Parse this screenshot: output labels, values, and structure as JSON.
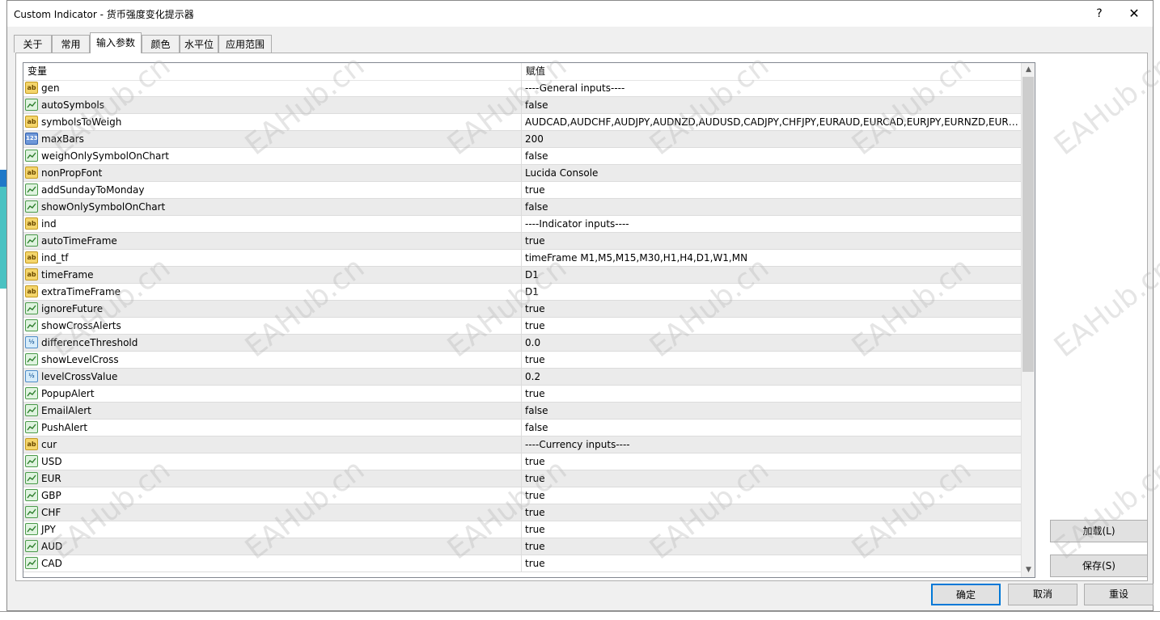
{
  "window": {
    "title": "Custom Indicator - 货币强度变化提示器",
    "help_label": "?",
    "close_label": "✕"
  },
  "tabs": [
    {
      "label": "关于"
    },
    {
      "label": "常用"
    },
    {
      "label": "输入参数"
    },
    {
      "label": "颜色"
    },
    {
      "label": "水平位"
    },
    {
      "label": "应用范围"
    }
  ],
  "grid": {
    "header_variable": "变量",
    "header_value": "赋值",
    "rows": [
      {
        "type": "string",
        "icon": "string-type-icon",
        "name": "gen",
        "value": "----General inputs----"
      },
      {
        "type": "bool",
        "icon": "bool-type-icon",
        "name": "autoSymbols",
        "value": "false"
      },
      {
        "type": "string",
        "icon": "string-type-icon",
        "name": "symbolsToWeigh",
        "value": "AUDCAD,AUDCHF,AUDJPY,AUDNZD,AUDUSD,CADJPY,CHFJPY,EURAUD,EURCAD,EURJPY,EURNZD,EURUS..."
      },
      {
        "type": "int",
        "icon": "int-type-icon",
        "name": "maxBars",
        "value": "200"
      },
      {
        "type": "bool",
        "icon": "bool-type-icon",
        "name": "weighOnlySymbolOnChart",
        "value": "false"
      },
      {
        "type": "string",
        "icon": "string-type-icon",
        "name": "nonPropFont",
        "value": "Lucida Console"
      },
      {
        "type": "bool",
        "icon": "bool-type-icon",
        "name": "addSundayToMonday",
        "value": "true"
      },
      {
        "type": "bool",
        "icon": "bool-type-icon",
        "name": "showOnlySymbolOnChart",
        "value": "false"
      },
      {
        "type": "string",
        "icon": "string-type-icon",
        "name": "ind",
        "value": "----Indicator inputs----"
      },
      {
        "type": "bool",
        "icon": "bool-type-icon",
        "name": "autoTimeFrame",
        "value": "true"
      },
      {
        "type": "string",
        "icon": "string-type-icon",
        "name": "ind_tf",
        "value": "timeFrame M1,M5,M15,M30,H1,H4,D1,W1,MN"
      },
      {
        "type": "string",
        "icon": "string-type-icon",
        "name": "timeFrame",
        "value": "D1"
      },
      {
        "type": "string",
        "icon": "string-type-icon",
        "name": "extraTimeFrame",
        "value": "D1"
      },
      {
        "type": "bool",
        "icon": "bool-type-icon",
        "name": "ignoreFuture",
        "value": "true"
      },
      {
        "type": "bool",
        "icon": "bool-type-icon",
        "name": "showCrossAlerts",
        "value": "true"
      },
      {
        "type": "double",
        "icon": "double-type-icon",
        "name": "differenceThreshold",
        "value": "0.0"
      },
      {
        "type": "bool",
        "icon": "bool-type-icon",
        "name": "showLevelCross",
        "value": "true"
      },
      {
        "type": "double",
        "icon": "double-type-icon",
        "name": "levelCrossValue",
        "value": "0.2"
      },
      {
        "type": "bool",
        "icon": "bool-type-icon",
        "name": "PopupAlert",
        "value": "true"
      },
      {
        "type": "bool",
        "icon": "bool-type-icon",
        "name": "EmailAlert",
        "value": "false"
      },
      {
        "type": "bool",
        "icon": "bool-type-icon",
        "name": "PushAlert",
        "value": "false"
      },
      {
        "type": "string",
        "icon": "string-type-icon",
        "name": "cur",
        "value": "----Currency inputs----"
      },
      {
        "type": "bool",
        "icon": "bool-type-icon",
        "name": "USD",
        "value": "true"
      },
      {
        "type": "bool",
        "icon": "bool-type-icon",
        "name": "EUR",
        "value": "true"
      },
      {
        "type": "bool",
        "icon": "bool-type-icon",
        "name": "GBP",
        "value": "true"
      },
      {
        "type": "bool",
        "icon": "bool-type-icon",
        "name": "CHF",
        "value": "true"
      },
      {
        "type": "bool",
        "icon": "bool-type-icon",
        "name": "JPY",
        "value": "true"
      },
      {
        "type": "bool",
        "icon": "bool-type-icon",
        "name": "AUD",
        "value": "true"
      },
      {
        "type": "bool",
        "icon": "bool-type-icon",
        "name": "CAD",
        "value": "true"
      }
    ]
  },
  "buttons": {
    "load": "加载(L)",
    "save": "保存(S)",
    "ok": "确定",
    "cancel": "取消",
    "reset": "重设"
  },
  "icon_glyphs": {
    "string": "ab",
    "int": "123",
    "double": "½"
  },
  "watermark": "EAHub.cn",
  "colors": {
    "focus_border": "#0078d7",
    "row_alt": "#ebebeb",
    "bool_icon": "#4a9a4a",
    "string_icon": "#f4d56b"
  }
}
